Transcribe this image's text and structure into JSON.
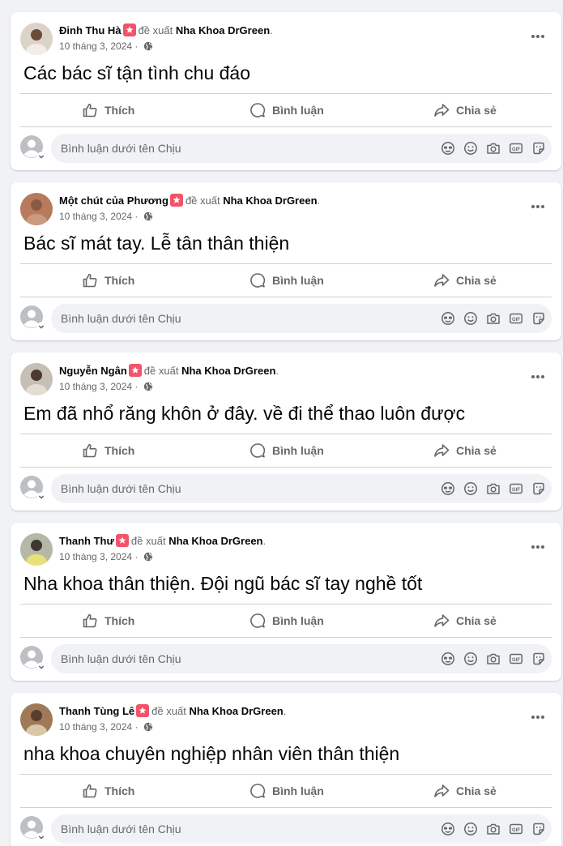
{
  "actions": {
    "like": "Thích",
    "comment": "Bình luận",
    "share": "Chia sẻ"
  },
  "comment_placeholder": "Bình luận dưới tên Chịu",
  "recommend_verb": "đề xuất",
  "page_name": "Nha Khoa DrGreen",
  "colors": {
    "background": "#f0f2f5",
    "card": "#ffffff",
    "muted_text": "#65676b",
    "recommend_badge": "#f35369"
  },
  "icons": [
    "recommend-icon",
    "globe-icon",
    "more-options-icon",
    "like-icon",
    "comment-icon",
    "share-icon",
    "avatar-icon",
    "sticker-emoji-icon",
    "emoji-icon",
    "camera-icon",
    "gif-icon",
    "sticker-icon"
  ],
  "posts": [
    {
      "author": "Đinh Thu Hà",
      "date": "10 tháng 3, 2024",
      "text": "Các bác sĩ tận tình chu đáo"
    },
    {
      "author": "Một chút của Phương",
      "date": "10 tháng 3, 2024",
      "text": "Bác sĩ mát tay. Lễ tân thân thiện"
    },
    {
      "author": "Nguyễn Ngân",
      "date": "10 tháng 3, 2024",
      "text": "Em đã nhổ răng khôn ở đây. về đi thể thao luôn được"
    },
    {
      "author": "Thanh Thư",
      "date": "10 tháng 3, 2024",
      "text": "Nha khoa thân thiện. Đội ngũ bác sĩ tay nghề tốt"
    },
    {
      "author": "Thanh Tùng Lê",
      "date": "10 tháng 3, 2024",
      "text": "nha khoa chuyên nghiệp nhân viên thân thiện"
    }
  ]
}
